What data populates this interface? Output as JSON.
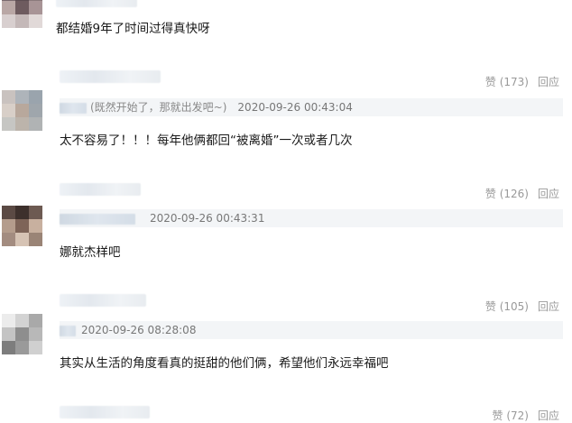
{
  "comments": [
    {
      "text": "都结婚9年了时间过得真快呀"
    },
    {
      "like": "赞 (173)",
      "reply": "回应",
      "quote_text": "(既然开始了，那就出发吧~)",
      "quote_time": "2020-09-26 00:43:04",
      "text": "太不容易了！！！每年他俩都回“被离婚”一次或者几次"
    },
    {
      "like": "赞 (126)",
      "reply": "回应",
      "quote_text": "",
      "quote_time": "2020-09-26 00:43:31",
      "text": "娜就杰样吧"
    },
    {
      "like": "赞 (105)",
      "reply": "回应",
      "quote_text": "",
      "quote_time": "2020-09-26 08:28:08",
      "text": "其实从生活的角度看真的挺甜的他们俩，希望他们永远幸福吧"
    },
    {
      "like": "赞 (72)",
      "reply": "回应"
    }
  ],
  "colors": {
    "meta": "#999999",
    "quote_bg": "#f3f5f7",
    "text": "#1a1a1a"
  }
}
